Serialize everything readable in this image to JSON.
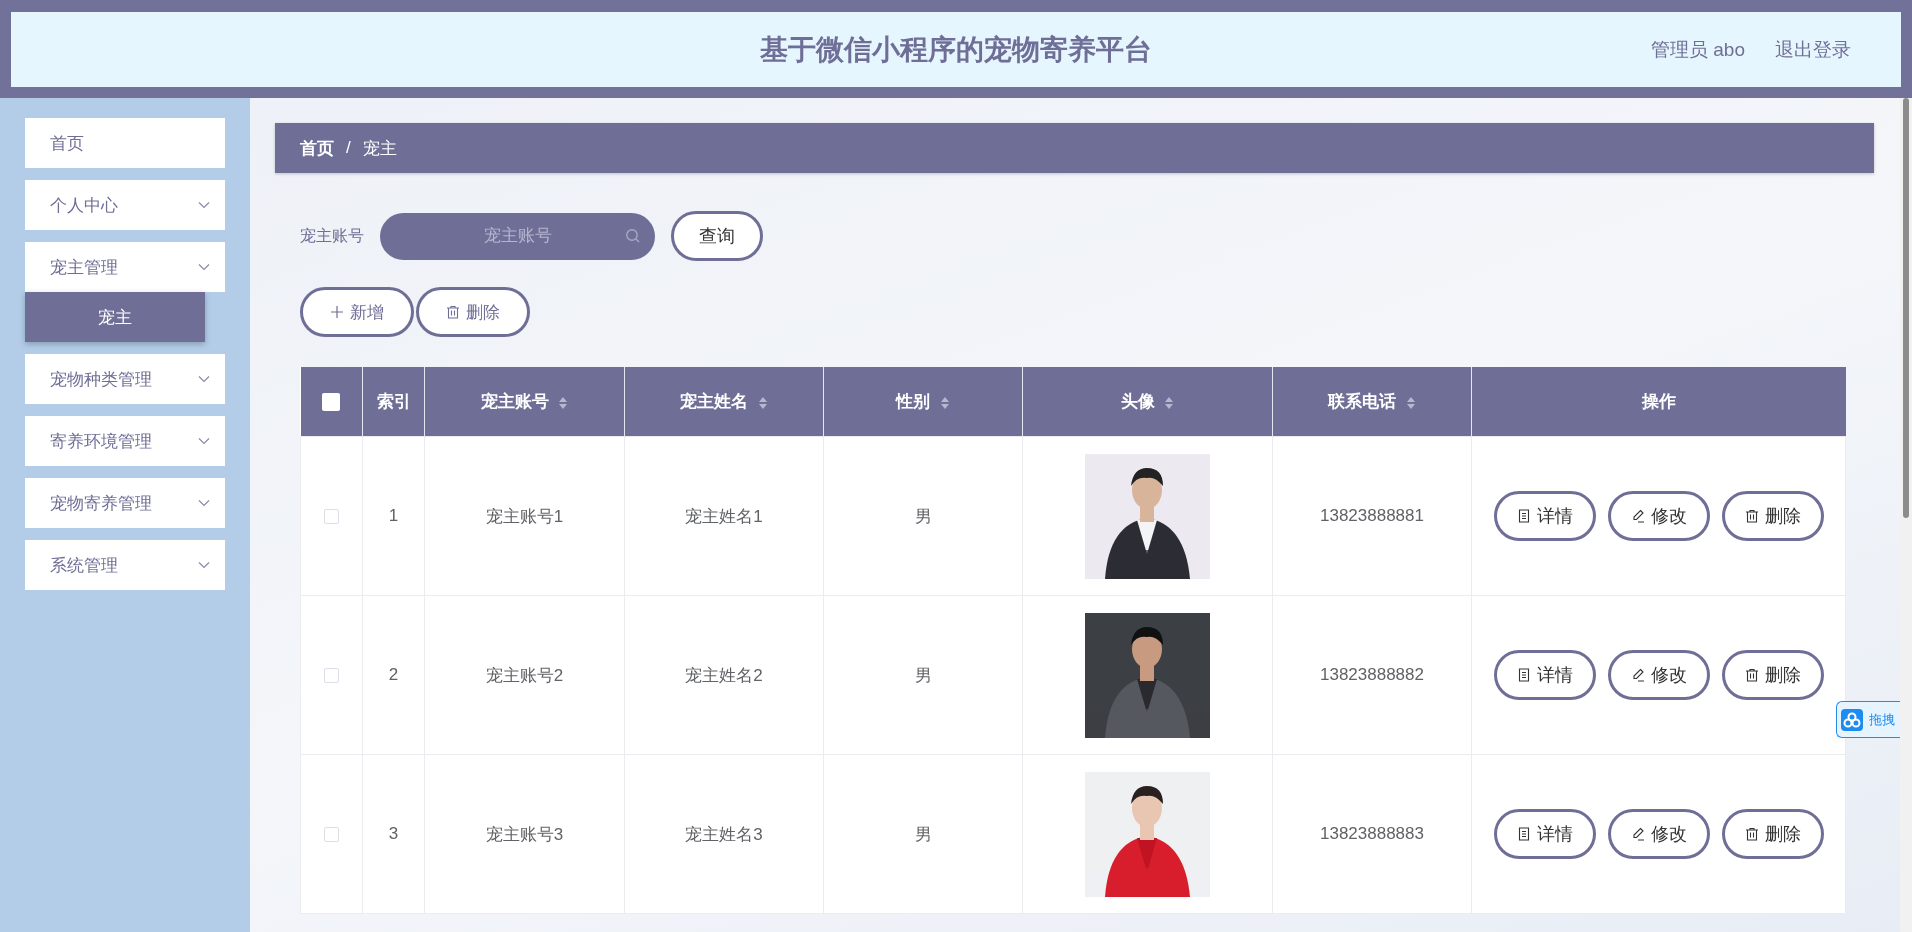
{
  "header": {
    "title": "基于微信小程序的宠物寄养平台",
    "user": "管理员 abo",
    "logout": "退出登录"
  },
  "sidebar": {
    "items": [
      {
        "label": "首页",
        "expandable": false
      },
      {
        "label": "个人中心",
        "expandable": true
      },
      {
        "label": "宠主管理",
        "expandable": true,
        "expanded": true,
        "children": [
          {
            "label": "宠主",
            "selected": true
          }
        ]
      },
      {
        "label": "宠物种类管理",
        "expandable": true
      },
      {
        "label": "寄养环境管理",
        "expandable": true
      },
      {
        "label": "宠物寄养管理",
        "expandable": true
      },
      {
        "label": "系统管理",
        "expandable": true
      }
    ]
  },
  "breadcrumb": {
    "items": [
      "首页",
      "宠主"
    ],
    "separator": "/"
  },
  "search": {
    "label": "宠主账号",
    "placeholder": "宠主账号",
    "button": "查询"
  },
  "actions": [
    {
      "kind": "add",
      "label": "新增"
    },
    {
      "kind": "delete",
      "label": "删除"
    }
  ],
  "table": {
    "select_all": {
      "checked": false
    },
    "columns": [
      {
        "label": "索引",
        "sortable": false
      },
      {
        "label": "宠主账号",
        "sortable": true
      },
      {
        "label": "宠主姓名",
        "sortable": true
      },
      {
        "label": "性别",
        "sortable": true
      },
      {
        "label": "头像",
        "sortable": true
      },
      {
        "label": "联系电话",
        "sortable": true
      },
      {
        "label": "操作",
        "sortable": false
      }
    ],
    "rows": [
      {
        "checked": false,
        "index": "1",
        "account": "宠主账号1",
        "name": "宠主姓名1",
        "gender": "男",
        "phone": "13823888881",
        "actions": [
          {
            "kind": "detail",
            "label": "详情"
          },
          {
            "kind": "edit",
            "label": "修改"
          },
          {
            "kind": "delete",
            "label": "删除"
          }
        ]
      },
      {
        "checked": false,
        "index": "2",
        "account": "宠主账号2",
        "name": "宠主姓名2",
        "gender": "男",
        "phone": "13823888882",
        "actions": [
          {
            "kind": "detail",
            "label": "详情"
          },
          {
            "kind": "edit",
            "label": "修改"
          },
          {
            "kind": "delete",
            "label": "删除"
          }
        ]
      },
      {
        "checked": false,
        "index": "3",
        "account": "宠主账号3",
        "name": "宠主姓名3",
        "gender": "男",
        "phone": "13823888883",
        "actions": [
          {
            "kind": "detail",
            "label": "详情"
          },
          {
            "kind": "edit",
            "label": "修改"
          },
          {
            "kind": "delete",
            "label": "删除"
          }
        ]
      }
    ]
  },
  "side_widget": {
    "label": "拖拽"
  }
}
